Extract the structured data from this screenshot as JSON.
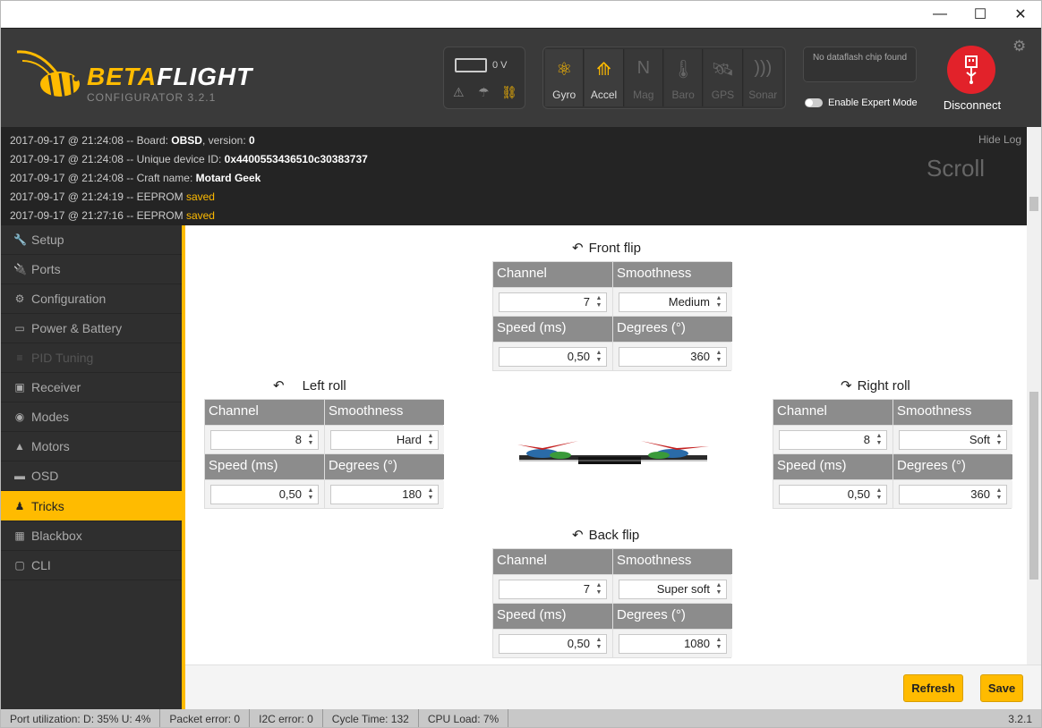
{
  "window": {
    "minimize": "—",
    "maximize": "☐",
    "close": "✕"
  },
  "app": {
    "logo": "BETAFLIGHT",
    "logo_prefix": "BETA",
    "logo_suffix": "FLIGHT",
    "subtitle": "CONFIGURATOR  3.2.1"
  },
  "battery": {
    "voltage": "0 V"
  },
  "sensors": [
    {
      "label": "Gyro",
      "icon": "gyro-icon",
      "active": true
    },
    {
      "label": "Accel",
      "icon": "accel-icon",
      "active": true
    },
    {
      "label": "Mag",
      "icon": "mag-icon",
      "active": false
    },
    {
      "label": "Baro",
      "icon": "baro-icon",
      "active": false
    },
    {
      "label": "GPS",
      "icon": "gps-icon",
      "active": false
    },
    {
      "label": "Sonar",
      "icon": "sonar-icon",
      "active": false
    }
  ],
  "dataflash": "No dataflash chip found",
  "expert_mode": "Enable Expert Mode",
  "disconnect": "Disconnect",
  "log": {
    "hide": "Hide Log",
    "scroll": "Scroll",
    "lines": [
      {
        "prefix": "2017-09-17 @ 21:24:08 -- Board: ",
        "bold": "OBSD",
        "mid": ", version: ",
        "bold2": "0",
        "hl": ""
      },
      {
        "prefix": "2017-09-17 @ 21:24:08 -- Unique device ID: ",
        "bold": "0x4400553436510c30383737",
        "mid": "",
        "bold2": "",
        "hl": ""
      },
      {
        "prefix": "2017-09-17 @ 21:24:08 -- Craft name: ",
        "bold": "Motard Geek",
        "mid": "",
        "bold2": "",
        "hl": ""
      },
      {
        "prefix": "2017-09-17 @ 21:24:19 -- EEPROM ",
        "bold": "",
        "mid": "",
        "bold2": "",
        "hl": "saved"
      },
      {
        "prefix": "2017-09-17 @ 21:27:16 -- EEPROM ",
        "bold": "",
        "mid": "",
        "bold2": "",
        "hl": "saved"
      }
    ]
  },
  "nav": [
    {
      "label": "Setup",
      "icon": "wrench-icon",
      "state": "normal"
    },
    {
      "label": "Ports",
      "icon": "plug-icon",
      "state": "normal"
    },
    {
      "label": "Configuration",
      "icon": "gear-icon",
      "state": "normal"
    },
    {
      "label": "Power & Battery",
      "icon": "battery-icon",
      "state": "normal"
    },
    {
      "label": "PID Tuning",
      "icon": "pid-icon",
      "state": "disabled"
    },
    {
      "label": "Receiver",
      "icon": "receiver-icon",
      "state": "normal"
    },
    {
      "label": "Modes",
      "icon": "modes-icon",
      "state": "normal"
    },
    {
      "label": "Motors",
      "icon": "motor-icon",
      "state": "normal"
    },
    {
      "label": "OSD",
      "icon": "osd-icon",
      "state": "normal"
    },
    {
      "label": "Tricks",
      "icon": "tricks-icon",
      "state": "active"
    },
    {
      "label": "Blackbox",
      "icon": "blackbox-icon",
      "state": "normal"
    },
    {
      "label": "CLI",
      "icon": "cli-icon",
      "state": "normal"
    }
  ],
  "labels": {
    "channel": "Channel",
    "smoothness": "Smoothness",
    "speed": "Speed (ms)",
    "degrees": "Degrees (°)"
  },
  "tricks": {
    "front": {
      "title": "Front flip",
      "channel": "7",
      "smoothness": "Medium",
      "speed": "0,50",
      "degrees": "360"
    },
    "left": {
      "title": "Left roll",
      "channel": "8",
      "smoothness": "Hard",
      "speed": "0,50",
      "degrees": "180"
    },
    "right": {
      "title": "Right roll",
      "channel": "8",
      "smoothness": "Soft",
      "speed": "0,50",
      "degrees": "360"
    },
    "back": {
      "title": "Back flip",
      "channel": "7",
      "smoothness": "Super soft",
      "speed": "0,50",
      "degrees": "1080"
    }
  },
  "buttons": {
    "refresh": "Refresh",
    "save": "Save"
  },
  "status": {
    "port": "Port utilization: D: 35% U: 4%",
    "packet": "Packet error: 0",
    "i2c": "I2C error: 0",
    "cycle": "Cycle Time: 132",
    "cpu": "CPU Load: 7%",
    "version": "3.2.1"
  },
  "colors": {
    "accent": "#ffbb00",
    "disconnect": "#e2222a"
  }
}
